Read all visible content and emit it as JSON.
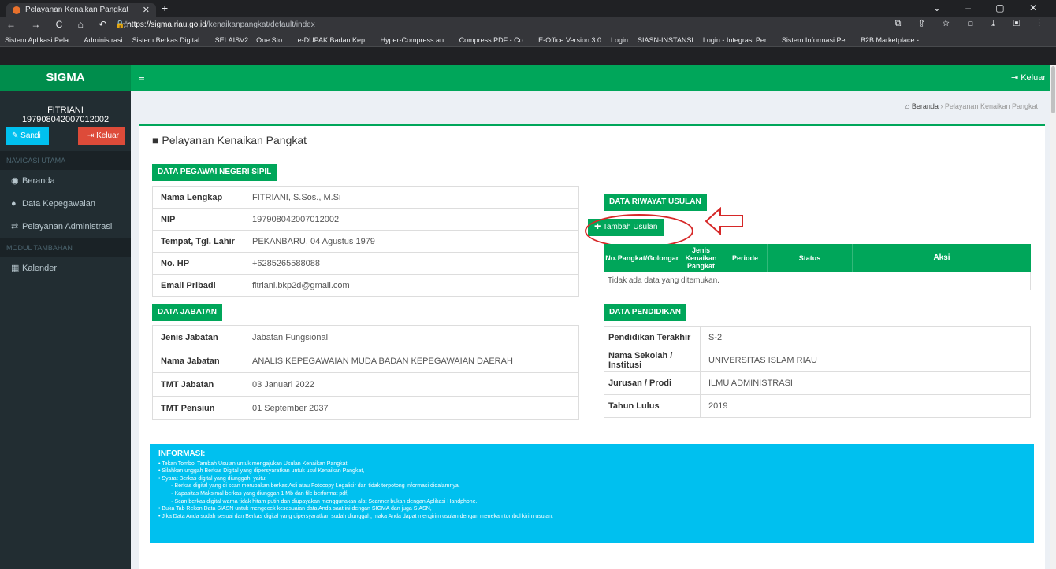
{
  "browser": {
    "tab_title": "Pelayanan Kenaikan Pangkat",
    "url_host": "https://sigma.riau.go.id",
    "url_path": "/kenaikanpangkat/default/index",
    "bookmarks": [
      "Sistem Aplikasi Pela...",
      "Administrasi",
      "Sistem Berkas Digital...",
      "SELAISV2 :: One Sto...",
      "e-DUPAK Badan Kep...",
      "Hyper-Compress an...",
      "Compress PDF - Co...",
      "E-Office Version 3.0",
      "Login",
      "SIASN-INSTANSI",
      "Login - Integrasi Per...",
      "Sistem Informasi Pe...",
      "B2B Marketplace -..."
    ]
  },
  "app": {
    "brand": "SIGMA",
    "logout": "Keluar"
  },
  "sidebar": {
    "user_name": "FITRIANI",
    "user_nip": "197908042007012002",
    "btn_password": "Sandi",
    "btn_logout": "Keluar",
    "section_main": "NAVIGASI UTAMA",
    "items": [
      "Beranda",
      "Data Kepegawaian",
      "Pelayanan Administrasi"
    ],
    "section_extra": "MODUL TAMBAHAN",
    "extra_items": [
      "Kalender"
    ]
  },
  "breadcrumb": {
    "home": "Beranda",
    "current": "Pelayanan Kenaikan Pangkat"
  },
  "page": {
    "title": "Pelayanan Kenaikan Pangkat"
  },
  "pns": {
    "header": "DATA PEGAWAI NEGERI SIPIL",
    "rows": [
      {
        "label": "Nama Lengkap",
        "value": "FITRIANI, S.Sos., M.Si"
      },
      {
        "label": "NIP",
        "value": "197908042007012002"
      },
      {
        "label": "Tempat, Tgl. Lahir",
        "value": "PEKANBARU, 04 Agustus 1979"
      },
      {
        "label": "No. HP",
        "value": "+6285265588088"
      },
      {
        "label": "Email Pribadi",
        "value": "fitriani.bkp2d@gmail.com"
      }
    ]
  },
  "jabatan": {
    "header": "DATA JABATAN",
    "rows": [
      {
        "label": "Jenis Jabatan",
        "value": "Jabatan Fungsional"
      },
      {
        "label": "Nama Jabatan",
        "value": "ANALIS KEPEGAWAIAN MUDA BADAN KEPEGAWAIAN DAERAH"
      },
      {
        "label": "TMT Jabatan",
        "value": "03 Januari 2022"
      },
      {
        "label": "TMT Pensiun",
        "value": "01 September 2037"
      }
    ]
  },
  "riwayat": {
    "header": "DATA RIWAYAT USULAN",
    "add_button": "Tambah Usulan",
    "columns": [
      "No.",
      "Pangkat/Golongan",
      "Jenis Kenaikan Pangkat",
      "Periode",
      "Status",
      "Aksi"
    ],
    "empty": "Tidak ada data yang ditemukan."
  },
  "pendidikan": {
    "header": "DATA PENDIDIKAN",
    "rows": [
      {
        "label": "Pendidikan Terakhir",
        "value": "S-2"
      },
      {
        "label": "Nama Sekolah / Institusi",
        "value": "UNIVERSITAS ISLAM RIAU"
      },
      {
        "label": "Jurusan / Prodi",
        "value": "ILMU ADMINISTRASI"
      },
      {
        "label": "Tahun Lulus",
        "value": "2019"
      }
    ]
  },
  "info": {
    "title": "INFORMASI:",
    "items": [
      "Tekan Tombol Tambah Usulan untuk mengajukan Usulan Kenaikan Pangkat,",
      "Silahkan unggah Berkas Digital yang dipersyaratkan untuk usul Kenaikan Pangkat,",
      "Syarat Berkas digital yang diunggah, yaitu:"
    ],
    "subitems": [
      "Berkas digital yang di scan merupakan berkas Asli atau Fotocopy Legalisir dan tidak terpotong informasi didalamnya,",
      "Kapasitas Maksimal berkas yang diunggah 1 Mb dan file berformat pdf,",
      "Scan berkas digital warna tidak hitam putih dan diupayakan menggunakan alat Scanner bukan dengan Aplikasi Handphone."
    ],
    "items2": [
      "Buka Tab Rekon Data SIASN untuk mengecek kesesuaian data Anda saat ini dengan SIGMA dan juga SIASN,",
      "Jika Data Anda sudah sesuai dan Berkas digital yang dipersyaratkan sudah diunggah, maka Anda dapat mengirim usulan dengan menekan tombol kirim usulan."
    ]
  }
}
